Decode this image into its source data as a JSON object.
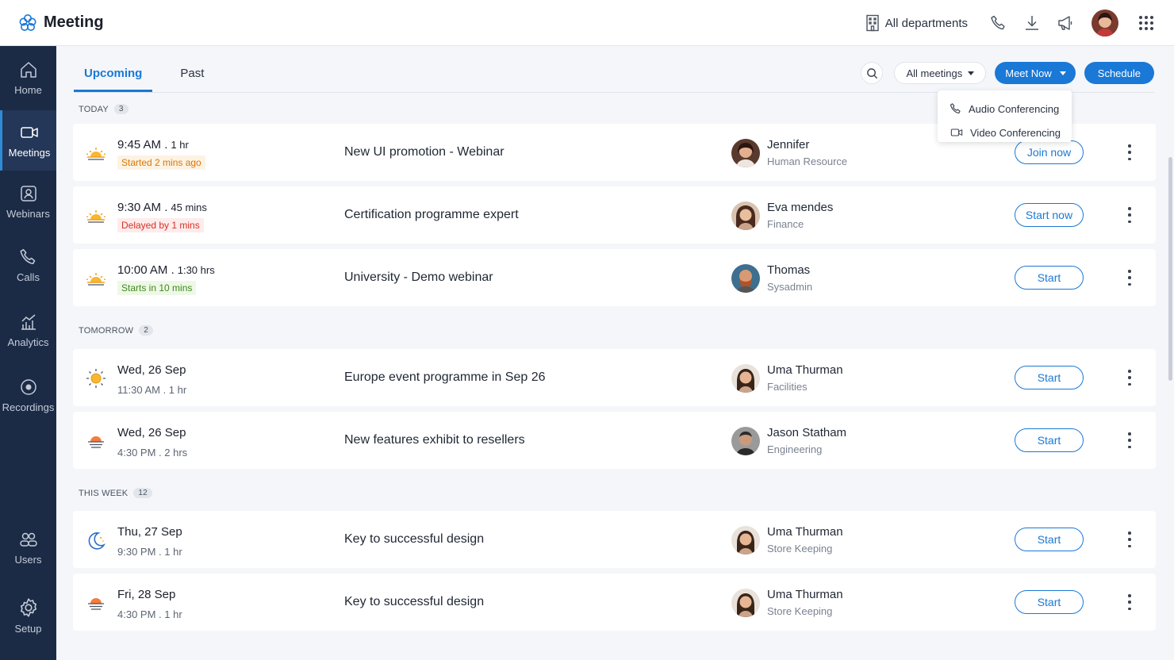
{
  "app": {
    "title": "Meeting"
  },
  "header": {
    "department": "All departments"
  },
  "sidebar": {
    "items": [
      {
        "label": "Home",
        "icon": "home-icon"
      },
      {
        "label": "Meetings",
        "icon": "video-icon"
      },
      {
        "label": "Webinars",
        "icon": "webinar-icon"
      },
      {
        "label": "Calls",
        "icon": "phone-icon"
      },
      {
        "label": "Analytics",
        "icon": "analytics-icon"
      },
      {
        "label": "Recordings",
        "icon": "record-icon"
      },
      {
        "label": "Users",
        "icon": "users-icon"
      },
      {
        "label": "Setup",
        "icon": "gear-icon"
      }
    ]
  },
  "tabs": [
    {
      "label": "Upcoming"
    },
    {
      "label": "Past"
    }
  ],
  "toolbar": {
    "filter_label": "All meetings",
    "meet_now_label": "Meet Now",
    "schedule_label": "Schedule"
  },
  "dropdown": {
    "items": [
      {
        "label": "Audio Conferencing"
      },
      {
        "label": "Video Conferencing"
      }
    ]
  },
  "colors": {
    "primary": "#1a78d6",
    "sidebar": "#1c2b45"
  },
  "groups": [
    {
      "label": "TODAY",
      "count": "3",
      "meetings": [
        {
          "time": "9:45 AM",
          "sep": ".",
          "duration": "1 hr",
          "status": "Started 2 mins ago",
          "title": "New UI promotion - Webinar",
          "host": "Jennifer",
          "dept": "Human Resource",
          "action": "Join now"
        },
        {
          "time": "9:30 AM",
          "sep": ".",
          "duration": "45 mins",
          "status": "Delayed by 1 mins",
          "title": "Certification programme expert",
          "host": "Eva mendes",
          "dept": "Finance",
          "action": "Start now"
        },
        {
          "time": "10:00 AM",
          "sep": ".",
          "duration": "1:30 hrs",
          "status": "Starts in 10 mins",
          "title": "University - Demo webinar",
          "host": "Thomas",
          "dept": "Sysadmin",
          "action": "Start"
        }
      ]
    },
    {
      "label": "TOMORROW",
      "count": "2",
      "meetings": [
        {
          "date": "Wed, 26 Sep",
          "sub": "11:30 AM .  1 hr",
          "title": "Europe event programme in Sep 26",
          "host": "Uma Thurman",
          "dept": "Facilities",
          "action": "Start"
        },
        {
          "date": "Wed, 26 Sep",
          "sub": "4:30 PM .  2 hrs",
          "title": "New features exhibit to resellers",
          "host": "Jason Statham",
          "dept": "Engineering",
          "action": "Start"
        }
      ]
    },
    {
      "label": "THIS WEEK",
      "count": "12",
      "meetings": [
        {
          "date": "Thu, 27 Sep",
          "sub": "9:30 PM .  1 hr",
          "title": "Key to successful design",
          "host": "Uma Thurman",
          "dept": "Store Keeping",
          "action": "Start"
        },
        {
          "date": "Fri, 28 Sep",
          "sub": "4:30 PM .  1 hr",
          "title": "Key to successful design",
          "host": "Uma Thurman",
          "dept": "Store Keeping",
          "action": "Start"
        }
      ]
    }
  ]
}
